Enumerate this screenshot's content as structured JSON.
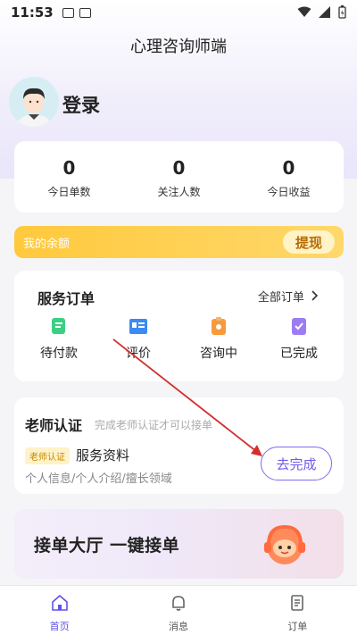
{
  "status_bar": {
    "time": "11:53"
  },
  "header": {
    "title": "心理咨询师端"
  },
  "profile": {
    "login_label": "登录"
  },
  "stats": [
    {
      "value": "0",
      "label": "今日单数"
    },
    {
      "value": "0",
      "label": "关注人数"
    },
    {
      "value": "0",
      "label": "今日收益"
    }
  ],
  "balance": {
    "label": "我的余额",
    "withdraw_label": "提现"
  },
  "orders": {
    "title": "服务订单",
    "all_label": "全部订单",
    "items": [
      {
        "label": "待付款",
        "icon": "wallet-icon"
      },
      {
        "label": "评价",
        "icon": "review-icon"
      },
      {
        "label": "咨询中",
        "icon": "consult-icon"
      },
      {
        "label": "已完成",
        "icon": "done-icon"
      }
    ]
  },
  "teacher": {
    "title": "老师认证",
    "subtitle": "完成老师认证才可以接单",
    "tag": "老师认证",
    "service_label": "服务资料",
    "service_desc": "个人信息/个人介绍/擅长领域",
    "finish_label": "去完成"
  },
  "banner": {
    "text": "接单大厅 一键接单"
  },
  "tabs": [
    {
      "label": "首页",
      "icon": "home-icon",
      "active": true
    },
    {
      "label": "消息",
      "icon": "bell-icon",
      "active": false
    },
    {
      "label": "订单",
      "icon": "order-icon",
      "active": false
    }
  ],
  "colors": {
    "accent": "#6f5ce8",
    "balance": "#ffc93d"
  }
}
